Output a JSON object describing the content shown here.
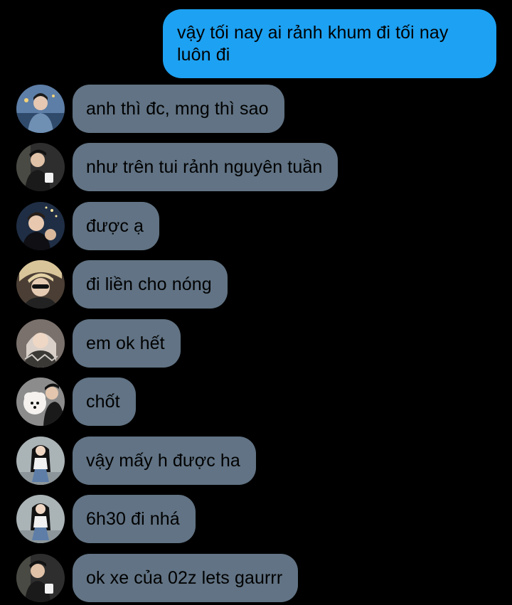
{
  "outgoing": {
    "text": "vậy tối nay ai rảnh khum đi tối nay luôn đi"
  },
  "messages": [
    {
      "text": "anh thì đc, mng thì sao",
      "avatar_tone": "#4a6a8c"
    },
    {
      "text": "như trên tui rảnh nguyên tuần",
      "avatar_tone": "#3a3a3a"
    },
    {
      "text": "được ạ",
      "avatar_tone": "#2c3d55"
    },
    {
      "text": "đi liền cho nóng",
      "avatar_tone": "#6b5a48"
    },
    {
      "text": "em ok hết",
      "avatar_tone": "#8a7f7a"
    },
    {
      "text": "chốt",
      "avatar_tone": "#d9d4cf"
    },
    {
      "text": "vậy mấy h được ha",
      "avatar_tone": "#9aa5a8"
    },
    {
      "text": "6h30 đi nhá",
      "avatar_tone": "#9aa5a8"
    },
    {
      "text": "ok xe của 02z lets gaurrr",
      "avatar_tone": "#3a3a3a"
    }
  ],
  "colors": {
    "background": "#000000",
    "outgoing_bubble": "#1DA1F2",
    "incoming_bubble": "#617384",
    "text": "#000000"
  }
}
